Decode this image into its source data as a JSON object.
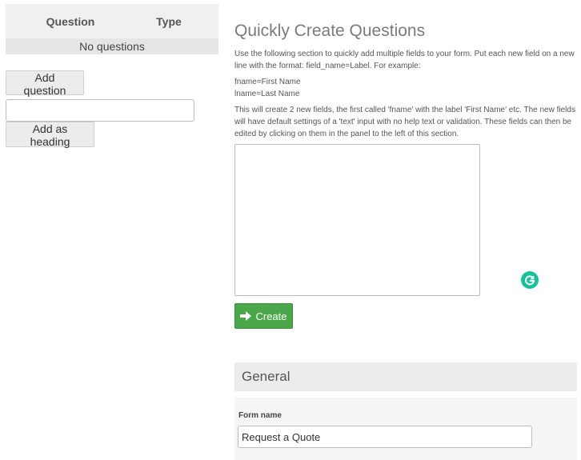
{
  "left_panel": {
    "table": {
      "columns": [
        "Question",
        "Type"
      ],
      "empty_text": "No questions"
    },
    "add_question_label": "Add question",
    "heading_input_value": "",
    "add_heading_label": "Add as heading"
  },
  "quick_create": {
    "title": "Quickly Create Questions",
    "intro": "Use the following section to quickly add multiple fields to your form. Put each new field on a new line with the format: field_name=Label. For example:",
    "example_lines": [
      "fname=First Name",
      "lname=Last Name"
    ],
    "explanation": "This will create 2 new fields, the first called 'fname' with the label 'First Name' etc. The new fields will have default settings of a 'text' input with no help text or validation. These fields can then be edited by clicking on them in the panel to the left of this section.",
    "textarea_value": "",
    "create_label": "Create"
  },
  "general": {
    "heading": "General",
    "form_name_label": "Form name",
    "form_name_value": "Request a Quote"
  },
  "colors": {
    "create_button": "#4aa84a",
    "grammarly": "#15c39a"
  },
  "icons": {
    "create": "arrow-right-icon",
    "extension": "grammarly-icon"
  }
}
